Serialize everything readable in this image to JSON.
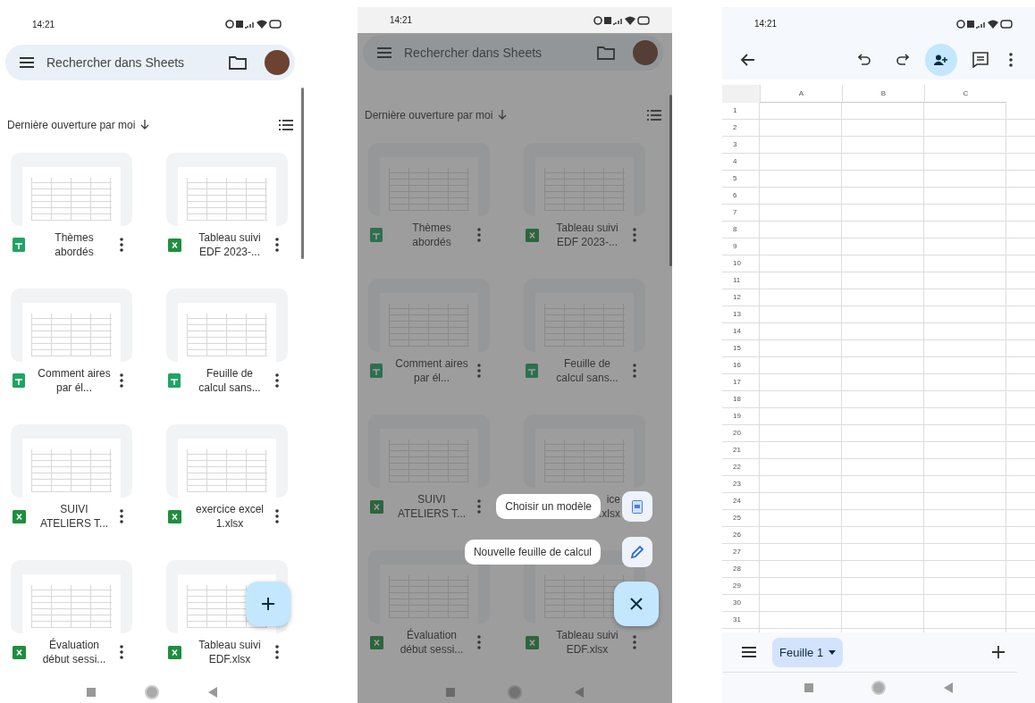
{
  "screens": [
    {
      "kind": "file_list",
      "dimmed": false,
      "status_bar": {
        "time": "14:21"
      },
      "search": {
        "placeholder": "Rechercher dans Sheets"
      },
      "sort_label": "Dernière ouverture par moi",
      "files": [
        {
          "name": "Thèmes abordés",
          "kind": "sheets"
        },
        {
          "name": "Tableau suivi EDF 2023-...",
          "kind": "excel"
        },
        {
          "name": "Comment aires par él...",
          "kind": "sheets"
        },
        {
          "name": "Feuille de calcul sans...",
          "kind": "sheets"
        },
        {
          "name": "SUIVI ATELIERS T...",
          "kind": "excel"
        },
        {
          "name": "exercice excel 1.xlsx",
          "kind": "excel"
        },
        {
          "name": "Évaluation début sessi...",
          "kind": "excel"
        },
        {
          "name": "Tableau suivi EDF.xlsx",
          "kind": "excel"
        }
      ],
      "fab": {
        "kind": "add"
      }
    },
    {
      "kind": "file_list",
      "dimmed": true,
      "status_bar": {
        "time": "14:21"
      },
      "search": {
        "placeholder": "Rechercher dans Sheets"
      },
      "sort_label": "Dernière ouverture par moi",
      "files": [
        {
          "name": "Thèmes abordés",
          "kind": "sheets"
        },
        {
          "name": "Tableau suivi EDF 2023-...",
          "kind": "excel"
        },
        {
          "name": "Comment aires par él...",
          "kind": "sheets"
        },
        {
          "name": "Feuille de calcul sans...",
          "kind": "sheets"
        },
        {
          "name": "SUIVI ATELIERS T...",
          "kind": "excel"
        },
        {
          "name": "ice\n.xlsx",
          "partly_covered": true
        },
        {
          "name": "Évaluation début sessi...",
          "kind": "excel"
        },
        {
          "name": "Tableau suivi EDF.xlsx",
          "kind": "excel"
        }
      ],
      "speed_dial": [
        {
          "label": "Choisir un modèle"
        },
        {
          "label": "Nouvelle feuille de calcul"
        }
      ],
      "fab": {
        "kind": "close"
      }
    },
    {
      "kind": "spreadsheet",
      "status_bar": {
        "time": "14:21"
      },
      "columns": [
        "A",
        "B",
        "C"
      ],
      "rows": [
        "1",
        "2",
        "3",
        "4",
        "5",
        "6",
        "7",
        "8",
        "9",
        "10",
        "11",
        "12",
        "13",
        "14",
        "15",
        "16",
        "17",
        "18",
        "19",
        "20",
        "21",
        "22",
        "23",
        "24",
        "25",
        "26",
        "27",
        "28",
        "29",
        "30",
        "31"
      ],
      "sheet_tabs": [
        {
          "label": "Feuille 1",
          "selected": true
        }
      ]
    }
  ]
}
